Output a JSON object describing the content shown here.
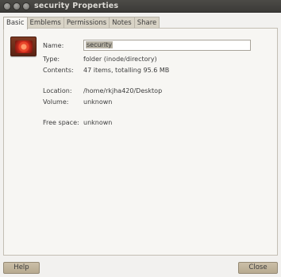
{
  "window": {
    "title": "security Properties"
  },
  "tabs": [
    {
      "label": "Basic",
      "active": true
    },
    {
      "label": "Emblems",
      "active": false
    },
    {
      "label": "Permissions",
      "active": false
    },
    {
      "label": "Notes",
      "active": false
    },
    {
      "label": "Share",
      "active": false
    }
  ],
  "icon": "folder-icon",
  "basic": {
    "name_label": "Name:",
    "name_value": "security",
    "type_label": "Type:",
    "type_value": "folder (inode/directory)",
    "contents_label": "Contents:",
    "contents_value": "47 items, totalling 95.6 MB",
    "location_label": "Location:",
    "location_value": "/home/rkjha420/Desktop",
    "volume_label": "Volume:",
    "volume_value": "unknown",
    "free_space_label": "Free space:",
    "free_space_value": "unknown"
  },
  "buttons": {
    "help": "Help",
    "close": "Close"
  }
}
